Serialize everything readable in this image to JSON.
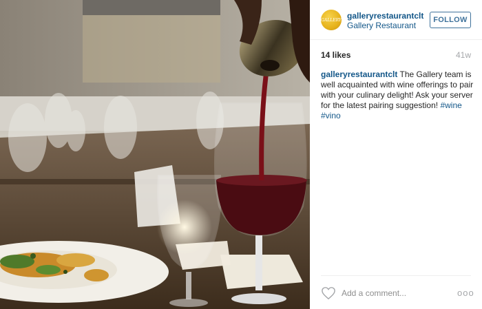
{
  "post": {
    "author": {
      "username": "galleryrestaurantclt",
      "full_name": "Gallery Restaurant",
      "avatar_text": "GALLERY"
    },
    "follow_label": "FOLLOW",
    "likes": "14 likes",
    "age": "41w",
    "caption": {
      "username": "galleryrestaurantclt",
      "text": " The Gallery team is well acquainted with wine offerings to pair with your culinary delight! Ask your server for the latest pairing suggestion! ",
      "hashtags": [
        "#wine",
        "#vino"
      ]
    },
    "comment_placeholder": "Add a comment...",
    "more_label": "ooo"
  },
  "colors": {
    "link": "#125688",
    "follow_border": "#3f729b",
    "muted": "#a5a7aa",
    "wine": "#5a0f14"
  },
  "icons": {
    "like": "heart-icon",
    "more": "more-options-icon"
  }
}
